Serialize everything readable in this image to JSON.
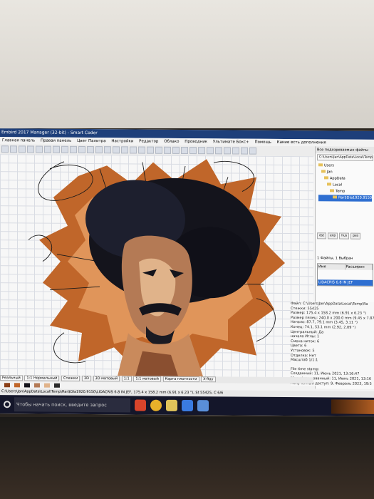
{
  "window": {
    "title": "Embird 2017 Manager (32-bit) - Smart Coder"
  },
  "menu": [
    "Главная панель",
    "Правая панель",
    "Цвет Палитра",
    "Настройки",
    "Редактор",
    "Облако",
    "Проводник",
    "Ультимате Бокс+",
    "Помощь",
    "Какие есть дополнения"
  ],
  "explorer": {
    "header": "Все подозреваемые файлы",
    "path": "C:\\Users\\Jan\\AppData\\Local\\Temp\\",
    "tree": [
      "Users",
      "Jan",
      "AppData",
      "Local",
      "Temp",
      "Rar$DIa1920.9150"
    ],
    "buttons": [
      "dst",
      "exp",
      "hus",
      "pes"
    ],
    "status": "1 Файлы, 1 Выбран",
    "columns": [
      "Имя",
      "Расширен"
    ],
    "selected_file": "LIDACRIS 6.8 IN JEF"
  },
  "info": [
    "Файл: C:\\Users\\Jan\\AppData\\Local\\Temp\\Ra",
    "Стежки: 55425",
    "Размер: 175.4 x 158.2 mm (6.91 x 6.23 \")",
    "Размер пялец: 240.0 x 200.0 mm (9.45 x 7.87",
    "Начало: 87.7, 79.1 mm (3.45, 3.11 \")",
    "Конец: 74.1, 53.1 mm (2.92, 2.09 \")",
    "Центральный: Да",
    "начало Иглы: 1",
    "Смена ниток: 6",
    "Цвета: 6",
    "Установок: 5",
    "Отделка: Нет",
    "Масштаб 1/1:1",
    "",
    "File time stamp:",
    "Созданный: 11, Июнь 2021, 13:16:47",
    "Модифицированный: 11, Июнь 2021, 13:16",
    "Полученный доступ: 9, Февраль 2023, 19:5"
  ],
  "tabs": [
    "Реальный",
    "1:1 Нормальный",
    "Стежки",
    "3D",
    "3D матовый",
    "1:1",
    "1:1 матовый",
    "Карта плотности",
    "X-Ray"
  ],
  "statusbar": "C:\\Users\\Jan\\AppData\\Local\\Temp\\Rar$DIa1920.9150\\LIDACRIS 6.8 IN JEF, 175.4 x 158.2 mm (6.91 x 6.23 \"), St 55425, C 6/6",
  "taskbar": {
    "search_placeholder": "Чтобы начать поиск, введите запрос"
  },
  "colors": {
    "orange": "#c0662a",
    "dark_orange": "#8a3f17",
    "black": "#14141c",
    "skin": "#b47a55",
    "light_skin": "#e0b38a"
  }
}
